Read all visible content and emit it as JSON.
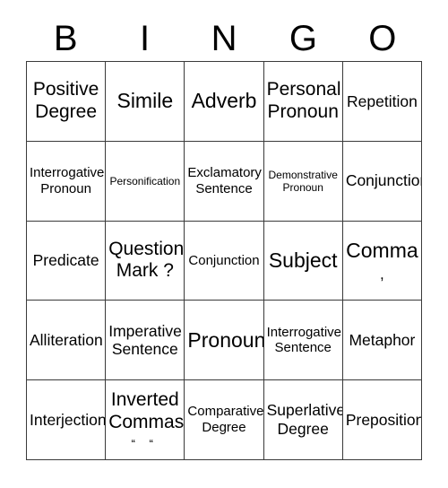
{
  "card": {
    "title": "BINGO",
    "header_letters": [
      "B",
      "I",
      "N",
      "G",
      "O"
    ],
    "grid_size": "5x5",
    "border_color": "#3a3a3a",
    "background_color": "#ffffff",
    "text_color": "#000000",
    "rows": [
      [
        {
          "label": "Positive\nDegree",
          "size": "lg"
        },
        {
          "label": "Simile",
          "size": "xl"
        },
        {
          "label": "Adverb",
          "size": "xl"
        },
        {
          "label": "Personal\nPronoun",
          "size": "lg"
        },
        {
          "label": "Repetition",
          "size": "md"
        }
      ],
      [
        {
          "label": "Interrogative\nPronoun",
          "size": "sm"
        },
        {
          "label": "Personification",
          "size": "xs"
        },
        {
          "label": "Exclamatory\nSentence",
          "size": "sm"
        },
        {
          "label": "Demonstrative\nPronoun",
          "size": "xs"
        },
        {
          "label": "Conjunction",
          "size": "md"
        }
      ],
      [
        {
          "label": "Predicate",
          "size": "md"
        },
        {
          "label": "Question\nMark ?",
          "size": "lg"
        },
        {
          "label": "Conjunction",
          "size": "sm"
        },
        {
          "label": "Subject",
          "size": "xl"
        },
        {
          "label": "Comma",
          "size": "xl",
          "symbol": ",",
          "symbol_style": "comma"
        }
      ],
      [
        {
          "label": "Alliteration",
          "size": "md"
        },
        {
          "label": "Imperative\nSentence",
          "size": "md"
        },
        {
          "label": "Pronoun",
          "size": "xl"
        },
        {
          "label": "Interrogative\nSentence",
          "size": "sm"
        },
        {
          "label": "Metaphor",
          "size": "md"
        }
      ],
      [
        {
          "label": "Interjection",
          "size": "md"
        },
        {
          "label": "Inverted\nCommas",
          "size": "lg",
          "symbol": "“ “",
          "symbol_style": "quotes"
        },
        {
          "label": "Comparative\nDegree",
          "size": "sm"
        },
        {
          "label": "Superlative\nDegree",
          "size": "md"
        },
        {
          "label": "Preposition",
          "size": "md"
        }
      ]
    ]
  }
}
